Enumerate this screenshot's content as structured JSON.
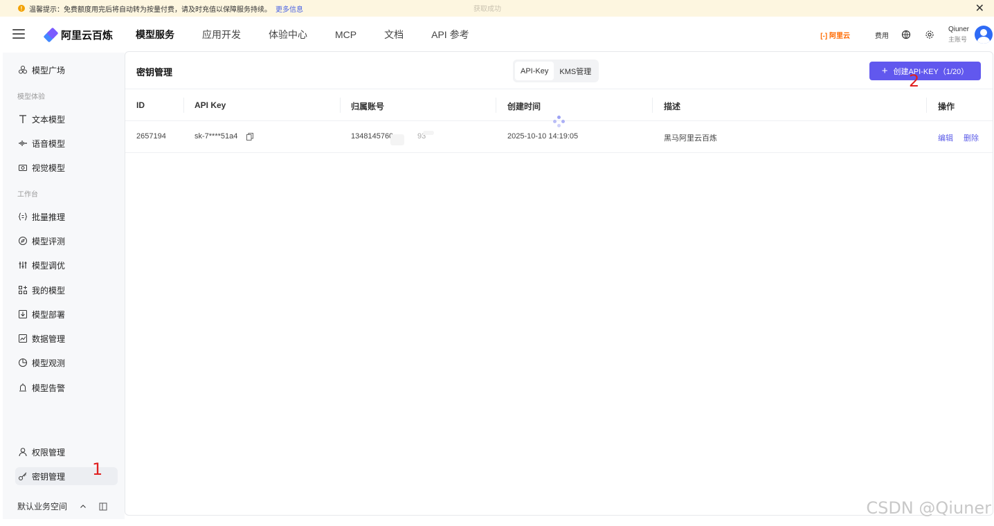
{
  "notice": {
    "text": "温馨提示：免费额度用完后将自动转为按量付费，请及时充值以保障服务持续。",
    "more_link": "更多信息",
    "ghost_text": "获取成功"
  },
  "header": {
    "logo_text": "阿里云百炼",
    "nav": [
      "模型服务",
      "应用开发",
      "体验中心",
      "MCP",
      "文档",
      "API 参考"
    ],
    "aliyun_label": "[-] 阿里云",
    "fee_label": "费用",
    "user_name": "Qiuner",
    "user_role": "主账号"
  },
  "sidebar": {
    "model_plaza": "模型广场",
    "group_experience": "模型体验",
    "text_model": "文本模型",
    "voice_model": "语音模型",
    "vision_model": "视觉模型",
    "group_workbench": "工作台",
    "batch_inference": "批量推理",
    "model_eval": "模型评测",
    "model_tuning": "模型调优",
    "my_models": "我的模型",
    "model_deploy": "模型部署",
    "data_management": "数据管理",
    "model_observe": "模型观测",
    "model_alert": "模型告警",
    "permission_mgmt": "权限管理",
    "key_mgmt": "密钥管理",
    "workspace": "默认业务空间"
  },
  "main": {
    "title": "密钥管理",
    "tabs": [
      "API-Key",
      "KMS管理"
    ],
    "create_button": "创建API-KEY（1/20）",
    "columns": [
      "ID",
      "API Key",
      "归属账号",
      "创建时间",
      "描述",
      "操作"
    ],
    "rows": [
      {
        "id": "2657194",
        "api_key": "sk-7****51a4",
        "account": "1348145760",
        "account_tail": "93",
        "created": "2025-10-10 14:19:05",
        "desc": "黑马阿里云百炼",
        "edit": "编辑",
        "delete": "删除"
      }
    ]
  },
  "annotations": {
    "one": "1",
    "two": "2"
  },
  "watermark": "CSDN @Qiuner",
  "colors": {
    "accent": "#6158ee",
    "link": "#5d5ee8",
    "notice_bg": "#fdf6e0",
    "annotation": "#e02020"
  }
}
